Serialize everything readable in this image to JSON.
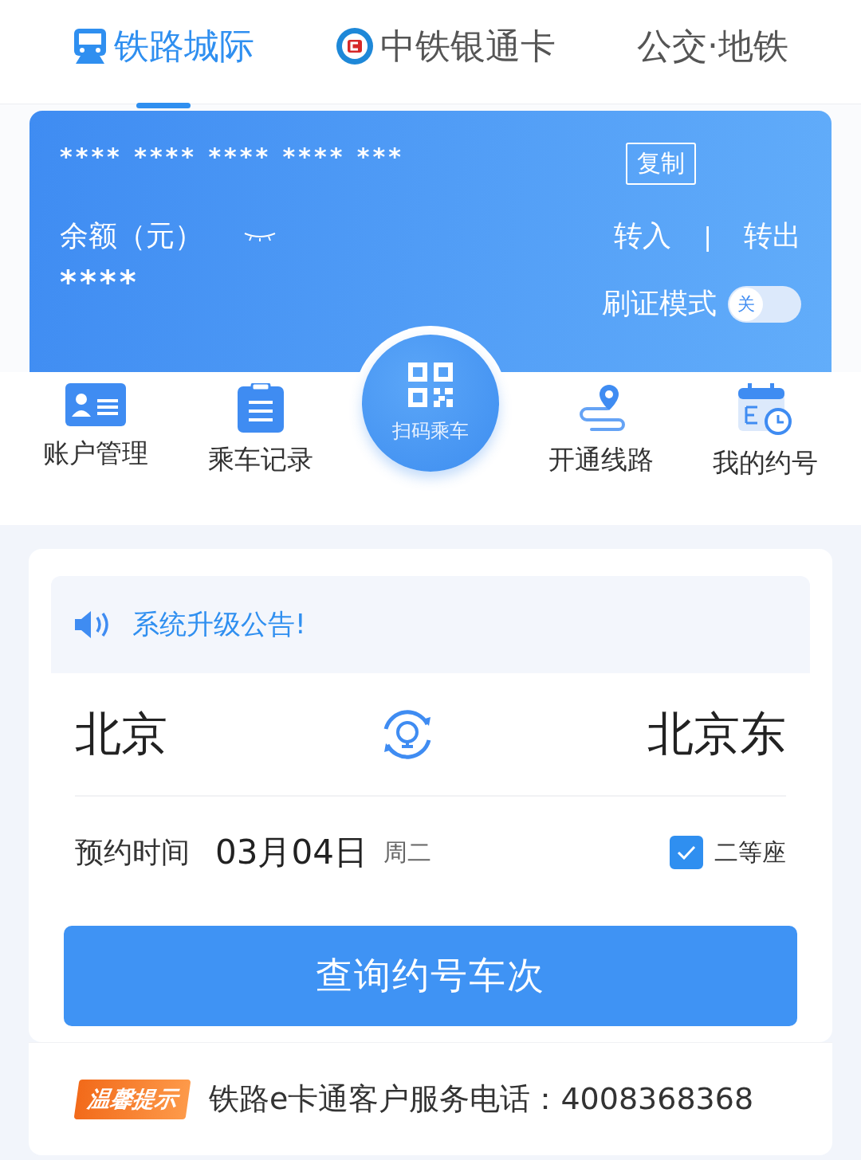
{
  "tabs": [
    {
      "label": "铁路城际",
      "selected": true,
      "kind": "train"
    },
    {
      "label": "中铁银通卡",
      "selected": false,
      "kind": "logo"
    },
    {
      "label": "公交·地铁",
      "selected": false,
      "kind": "plain"
    }
  ],
  "card": {
    "number": "**** **** **** **** ***",
    "copy": "复制",
    "balance_label": "余额（元）",
    "balance": "****",
    "transfer_in": "转入",
    "separator": "|",
    "transfer_out": "转出",
    "id_mode": {
      "label": "刷证模式",
      "on": false,
      "off_text": "关"
    }
  },
  "actions": [
    {
      "label": "账户管理",
      "kind": "account"
    },
    {
      "label": "乘车记录",
      "kind": "clipboard"
    },
    {
      "label": "扫码乘车",
      "kind": "scan"
    },
    {
      "label": "开通线路",
      "kind": "route"
    },
    {
      "label": "我的约号",
      "kind": "calendar"
    }
  ],
  "notice": "系统升级公告!",
  "trip": {
    "from": "北京",
    "to": "北京东",
    "date_label": "预约时间",
    "date": "03月04日",
    "weekday": "周二",
    "seat": {
      "label": "二等座",
      "checked": true
    },
    "search": "查询约号车次"
  },
  "tip": {
    "badge": "温馨提示",
    "text": "铁路e卡通客户服务电话：4008368368"
  }
}
